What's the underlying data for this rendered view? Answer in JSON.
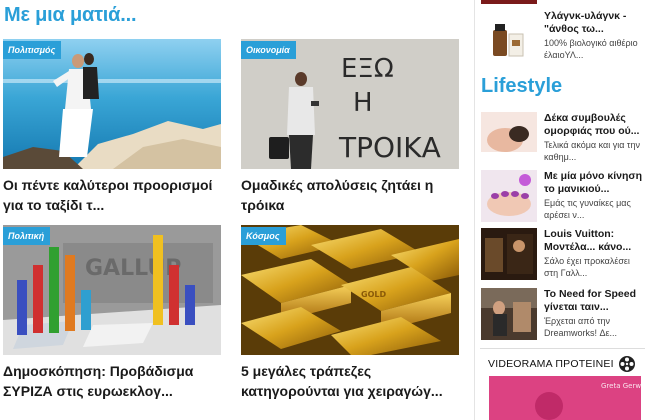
{
  "main": {
    "section_title": "Με μια ματιά...",
    "cards": [
      {
        "category": "Πολιτισμός",
        "headline_line1": "Οι πέντε καλύτεροι προορισμοί",
        "headline_line2": "για το ταξίδι τ..."
      },
      {
        "category": "Οικονομία",
        "headline_line1": "Ομαδικές απολύσεις ζητάει η",
        "headline_line2": "τρόικα",
        "wall_text_1": "ΕΞΩ",
        "wall_text_2": "Η",
        "wall_text_3": "ΤΡΟΙΚΑ"
      },
      {
        "category": "Πολιτική",
        "headline_line1": "Δημοσκόπηση: Προβάδισμα",
        "headline_line2": "ΣΥΡΙΖΑ στις ευρωεκλογ...",
        "bg_text": "GALLUP"
      },
      {
        "category": "Κόσμος",
        "headline_line1": "5 μεγάλες τράπεζες",
        "headline_line2": "κατηγορούνται για χειραγώγ...",
        "bar_text": "GOLD"
      }
    ]
  },
  "sidebar": {
    "top_item": {
      "title_line1": "Υλάγνκ-υλάγνκ -",
      "title_line2": "\"άνθος τω...",
      "desc_line1": "100% βιολογικό αιθέριο",
      "desc_line2": "έλαιοΥΛ..."
    },
    "lifestyle_title": "Lifestyle",
    "items": [
      {
        "title_line1": "Δέκα συμβουλές",
        "title_line2": "ομορφιάς που ού...",
        "desc_line1": "Τελικά ακόμα και για την",
        "desc_line2": "καθημ..."
      },
      {
        "title_line1": "Με μία μόνο κίνηση",
        "title_line2": "το μανικιού...",
        "desc_line1": "Εμάς τις γυναίκες μας",
        "desc_line2": "αρέσει ν..."
      },
      {
        "title_line1": "Louis Vuitton:",
        "title_line2": "Μοντέλα... κάνο...",
        "desc_line1": "Σάλο έχει προκαλέσει",
        "desc_line2": "στη Γαλλ..."
      },
      {
        "title_line1": "To Need for Speed",
        "title_line2": "γίνεται ταιν...",
        "desc_line1": "Έρχεται από την",
        "desc_line2": "Dreamworks! Δε..."
      }
    ],
    "videorama": {
      "label": "VIDEORAMA ΠΡΟΤΕΙΝΕΙ",
      "thumb_caption": "Greta Gerwig"
    }
  },
  "colors": {
    "accent": "#2a9fd8",
    "text": "#1a1a1a",
    "muted": "#444444"
  },
  "icons": {
    "videorama": "film-reel-icon"
  }
}
